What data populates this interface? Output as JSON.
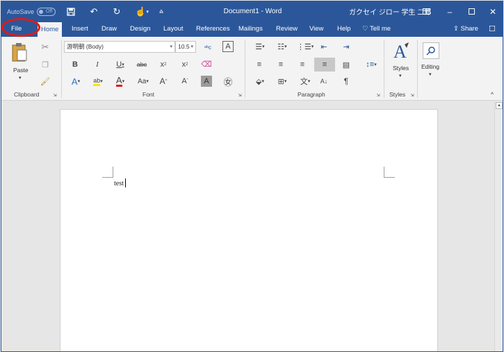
{
  "titlebar": {
    "autosave_label": "AutoSave",
    "autosave_state": "Off",
    "document_title": "Document1 - Word",
    "user_name": "ガクセイ ジロー 学生 二郎"
  },
  "tabs": [
    {
      "label": "File"
    },
    {
      "label": "Home"
    },
    {
      "label": "Insert"
    },
    {
      "label": "Draw"
    },
    {
      "label": "Design"
    },
    {
      "label": "Layout"
    },
    {
      "label": "References"
    },
    {
      "label": "Mailings"
    },
    {
      "label": "Review"
    },
    {
      "label": "View"
    },
    {
      "label": "Help"
    },
    {
      "label": "Tell me"
    }
  ],
  "share_label": "Share",
  "ribbon": {
    "clipboard": {
      "paste_label": "Paste",
      "group_label": "Clipboard"
    },
    "font": {
      "font_name": "游明朝 (Body)",
      "font_size": "10.5",
      "group_label": "Font"
    },
    "paragraph": {
      "group_label": "Paragraph"
    },
    "styles": {
      "styles_label": "Styles",
      "group_label": "Styles"
    },
    "editing": {
      "editing_label": "Editing"
    }
  },
  "document": {
    "body_text": "test"
  },
  "accent_color": "#2b579a",
  "highlight_color": "#e01a1a"
}
